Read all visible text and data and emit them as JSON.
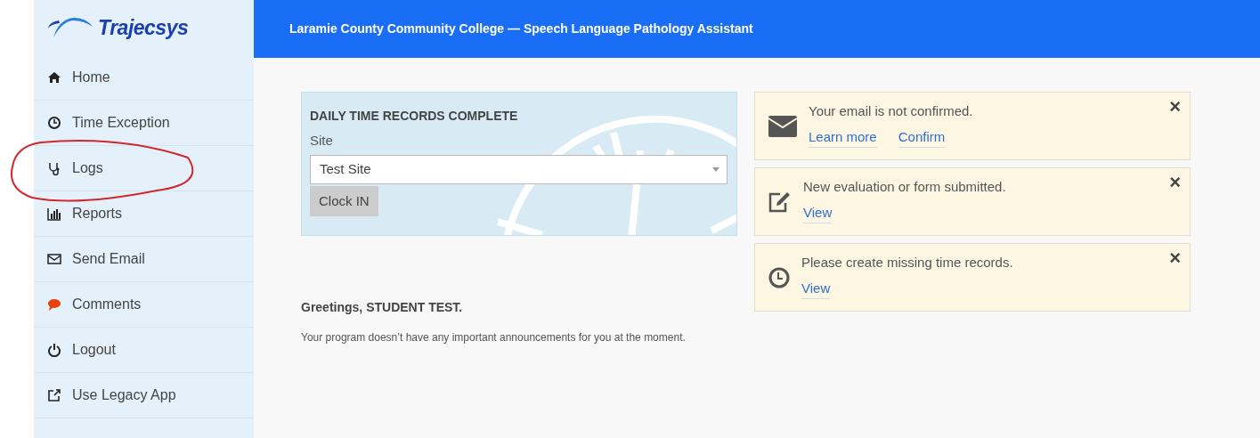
{
  "logo": {
    "text": "Trajecsys"
  },
  "header": {
    "title": "Laramie County Community College — Speech Language Pathology Assistant"
  },
  "sidebar": {
    "items": [
      {
        "label": "Home",
        "circled": false
      },
      {
        "label": "Time Exception",
        "circled": false
      },
      {
        "label": "Logs",
        "circled": true
      },
      {
        "label": "Reports",
        "circled": false
      },
      {
        "label": "Send Email",
        "circled": false
      },
      {
        "label": "Comments",
        "circled": false
      },
      {
        "label": "Logout",
        "circled": false
      },
      {
        "label": "Use Legacy App",
        "circled": false
      }
    ]
  },
  "clock_card": {
    "title": "DAILY TIME RECORDS COMPLETE",
    "site_label": "Site",
    "site_value": "Test Site",
    "button": "Clock IN"
  },
  "notices": [
    {
      "message": "Your email is not confirmed.",
      "links": [
        "Learn more",
        "Confirm"
      ],
      "close": "×"
    },
    {
      "message": "New evaluation or form submitted.",
      "links": [
        "View"
      ],
      "close": "×"
    },
    {
      "message": "Please create missing time records.",
      "links": [
        "View"
      ],
      "close": "×"
    }
  ],
  "greeting": "Greetings, STUDENT TEST.",
  "announcement": "Your program doesn’t have any important announcements for you at the moment."
}
